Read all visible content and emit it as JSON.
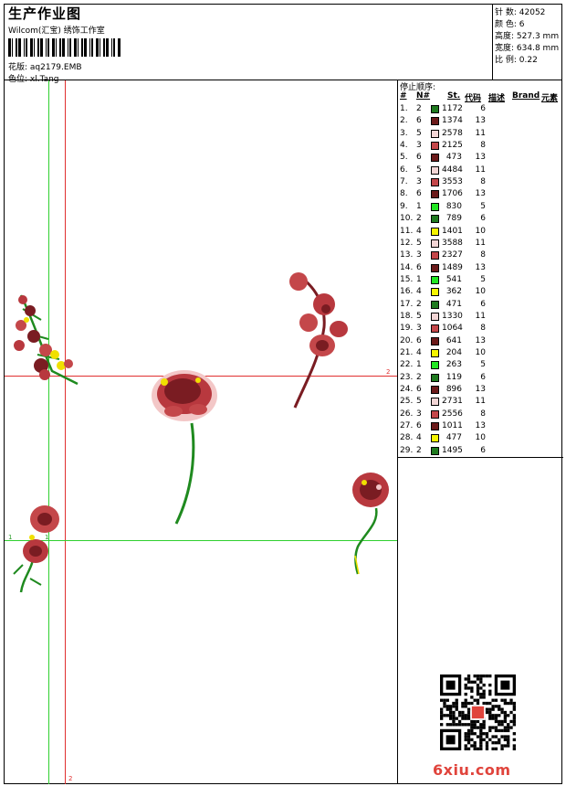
{
  "header": {
    "title": "生产作业图",
    "subtitle": "Wilcom(汇宝) 绣饰工作室",
    "design_label": "花版: aq2179.EMB",
    "color_seq_label": "色位: xl.Tang"
  },
  "meta": [
    {
      "label": "针 数:",
      "value": "42052"
    },
    {
      "label": "颜 色:",
      "value": "6"
    },
    {
      "label": "高度:",
      "value": "527.3 mm"
    },
    {
      "label": "宽度:",
      "value": "634.8 mm"
    },
    {
      "label": "比 例:",
      "value": "0.22"
    }
  ],
  "axis_labels": {
    "h_red": "2",
    "v_red": "2",
    "h_green": "1",
    "v_green": "1"
  },
  "stop_table": {
    "title": "停止顺序:",
    "headers": {
      "num": "#",
      "needle": "N#",
      "stitches": "St.",
      "code": "代码",
      "desc": "描述",
      "brand": "Brand",
      "element": "元素"
    },
    "rows": [
      {
        "n": "1.",
        "needle": "2",
        "color": "#1f7a1f",
        "st": "1172",
        "code": "6"
      },
      {
        "n": "2.",
        "needle": "6",
        "color": "#6b1a1a",
        "st": "1374",
        "code": "13"
      },
      {
        "n": "3.",
        "needle": "5",
        "color": "#f2d5d5",
        "st": "2578",
        "code": "11"
      },
      {
        "n": "4.",
        "needle": "3",
        "color": "#c4474a",
        "st": "2125",
        "code": "8"
      },
      {
        "n": "5.",
        "needle": "6",
        "color": "#6b1a1a",
        "st": "473",
        "code": "13"
      },
      {
        "n": "6.",
        "needle": "5",
        "color": "#f2d5d5",
        "st": "4484",
        "code": "11"
      },
      {
        "n": "7.",
        "needle": "3",
        "color": "#c4474a",
        "st": "3553",
        "code": "8"
      },
      {
        "n": "8.",
        "needle": "6",
        "color": "#6b1a1a",
        "st": "1706",
        "code": "13"
      },
      {
        "n": "9.",
        "needle": "1",
        "color": "#22e622",
        "st": "830",
        "code": "5"
      },
      {
        "n": "10.",
        "needle": "2",
        "color": "#1f7a1f",
        "st": "789",
        "code": "6"
      },
      {
        "n": "11.",
        "needle": "4",
        "color": "#f5f500",
        "st": "1401",
        "code": "10"
      },
      {
        "n": "12.",
        "needle": "5",
        "color": "#f2d5d5",
        "st": "3588",
        "code": "11"
      },
      {
        "n": "13.",
        "needle": "3",
        "color": "#c4474a",
        "st": "2327",
        "code": "8"
      },
      {
        "n": "14.",
        "needle": "6",
        "color": "#6b1a1a",
        "st": "1489",
        "code": "13"
      },
      {
        "n": "15.",
        "needle": "1",
        "color": "#22e622",
        "st": "541",
        "code": "5"
      },
      {
        "n": "16.",
        "needle": "4",
        "color": "#f5f500",
        "st": "362",
        "code": "10"
      },
      {
        "n": "17.",
        "needle": "2",
        "color": "#1f7a1f",
        "st": "471",
        "code": "6"
      },
      {
        "n": "18.",
        "needle": "5",
        "color": "#f2d5d5",
        "st": "1330",
        "code": "11"
      },
      {
        "n": "19.",
        "needle": "3",
        "color": "#c4474a",
        "st": "1064",
        "code": "8"
      },
      {
        "n": "20.",
        "needle": "6",
        "color": "#6b1a1a",
        "st": "641",
        "code": "13"
      },
      {
        "n": "21.",
        "needle": "4",
        "color": "#f5f500",
        "st": "204",
        "code": "10"
      },
      {
        "n": "22.",
        "needle": "1",
        "color": "#22e622",
        "st": "263",
        "code": "5"
      },
      {
        "n": "23.",
        "needle": "2",
        "color": "#1f7a1f",
        "st": "119",
        "code": "6"
      },
      {
        "n": "24.",
        "needle": "6",
        "color": "#6b1a1a",
        "st": "896",
        "code": "13"
      },
      {
        "n": "25.",
        "needle": "5",
        "color": "#f2d5d5",
        "st": "2731",
        "code": "11"
      },
      {
        "n": "26.",
        "needle": "3",
        "color": "#c4474a",
        "st": "2556",
        "code": "8"
      },
      {
        "n": "27.",
        "needle": "6",
        "color": "#6b1a1a",
        "st": "1011",
        "code": "13"
      },
      {
        "n": "28.",
        "needle": "4",
        "color": "#f5f500",
        "st": "477",
        "code": "10"
      },
      {
        "n": "29.",
        "needle": "2",
        "color": "#1f7a1f",
        "st": "1495",
        "code": "6"
      }
    ]
  },
  "watermark": "6xiu.com",
  "colors": {
    "guide_red": "#e03030",
    "guide_green": "#30d030",
    "flower_dark": "#7a1c22",
    "flower_mid": "#b8383e",
    "flower_light": "#f3c7c7",
    "stem": "#1f8a1f",
    "accent_yellow": "#f0e000"
  }
}
